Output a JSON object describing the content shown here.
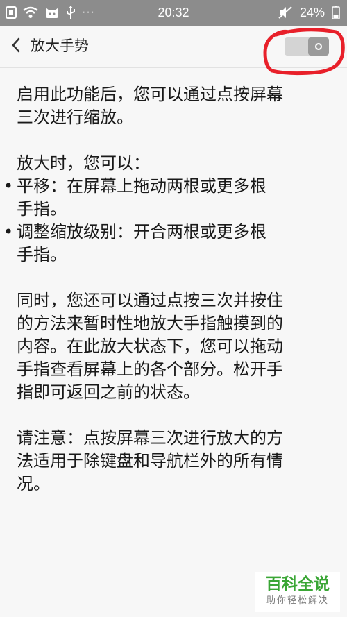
{
  "status_bar": {
    "time": "20:32",
    "battery": "24%",
    "more_dots": "···"
  },
  "header": {
    "back_icon": "chevron-left-icon",
    "title": "放大手势",
    "toggle_state": "off"
  },
  "content": {
    "intro": [
      "启用此功能后，您可以通过点按屏幕",
      "三次进行缩放。"
    ],
    "zoom_heading": "放大时，您可以：",
    "bullets": [
      [
        "平移：在屏幕上拖动两根或更多根",
        "手指。"
      ],
      [
        "调整缩放级别：开合两根或更多根",
        "手指。"
      ]
    ],
    "temp_zoom": [
      "同时，您还可以通过点按三次并按住",
      "的方法来暂时性地放大手指触摸到的",
      "内容。在此放大状态下，您可以拖动",
      "手指查看屏幕上的各个部分。松开手",
      "指即可返回之前的状态。"
    ],
    "note": [
      "请注意：点按屏幕三次进行放大的方",
      "法适用于除键盘和导航栏外的所有情",
      "况。"
    ],
    "bullet_symbol": "•"
  },
  "watermark": {
    "brand": "百科全说",
    "slogan": "助你轻松解决"
  },
  "colors": {
    "status_bar_bg": "#8c8c8c",
    "background": "#f7f7f7",
    "annotation": "#e8202a",
    "watermark_green": "#3aa635"
  }
}
